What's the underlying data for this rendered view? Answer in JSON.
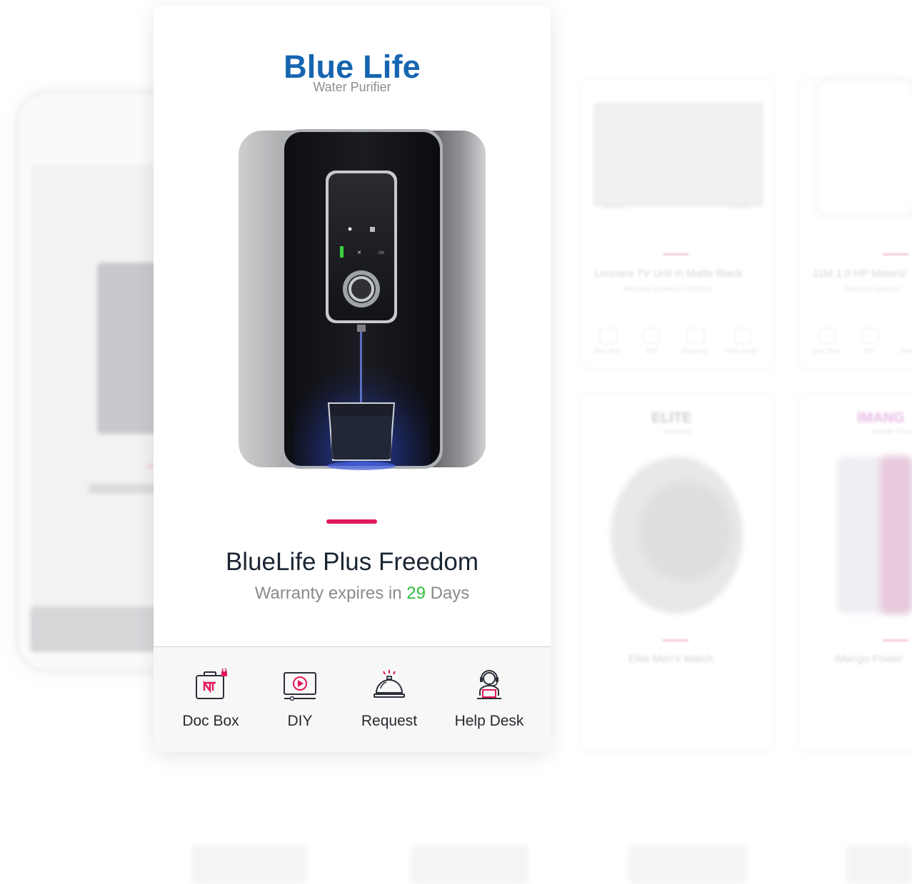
{
  "product": {
    "brand": "Blue Life",
    "category": "Water Purifier",
    "name": "BlueLife Plus Freedom",
    "warranty_prefix": "Warranty expires in",
    "warranty_days": "29",
    "warranty_suffix": "Days"
  },
  "actions": [
    {
      "label": "Doc Box",
      "icon": "doc-box-icon"
    },
    {
      "label": "DIY",
      "icon": "diy-video-icon"
    },
    {
      "label": "Request",
      "icon": "service-bell-icon"
    },
    {
      "label": "Help Desk",
      "icon": "support-agent-icon"
    }
  ],
  "background_cards": [
    {
      "title": "Leonara TV Unit in Matte Black",
      "warranty": "Warranty expires in 29 Days",
      "actions": [
        "Doc Box",
        "DIY",
        "Request",
        "Help Desk"
      ]
    },
    {
      "title": "11M 1.0 HP Motoriz",
      "warranty": "Warranty expires i",
      "actions": [
        "Doc Box",
        "DIY",
        "Req"
      ]
    },
    {
      "brand": "ELITE",
      "category": "Watches",
      "title": "Elite Men's Watch"
    },
    {
      "brand": "IMANG",
      "category": "Mobile Phone",
      "title": "iMango Power"
    }
  ],
  "colors": {
    "brand_blue": "#1665b0",
    "accent_pink": "#e2185a",
    "warranty_green": "#2ebd3b",
    "text_dark": "#1b2533",
    "text_muted": "#8a8a8a"
  }
}
